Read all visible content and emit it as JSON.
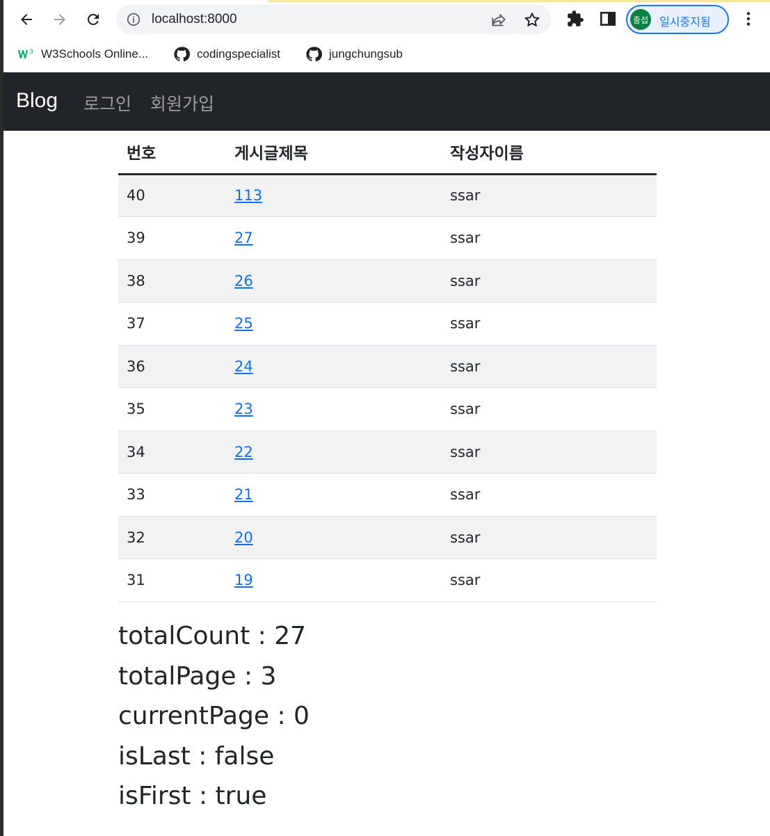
{
  "browser": {
    "url": "localhost:8000",
    "profile": {
      "avatar_text": "충섭",
      "label": "일시중지됨"
    },
    "bookmarks": [
      {
        "label": "W3Schools Online...",
        "icon": "w3schools-icon"
      },
      {
        "label": "codingspecialist",
        "icon": "github-icon"
      },
      {
        "label": "jungchungsub",
        "icon": "github-icon"
      }
    ]
  },
  "navbar": {
    "brand": "Blog",
    "links": [
      "로그인",
      "회원가입"
    ]
  },
  "table": {
    "headers": [
      "번호",
      "게시글제목",
      "작성자이름"
    ],
    "rows": [
      {
        "id": "40",
        "title": "113",
        "author": "ssar"
      },
      {
        "id": "39",
        "title": "27",
        "author": "ssar"
      },
      {
        "id": "38",
        "title": "26",
        "author": "ssar"
      },
      {
        "id": "37",
        "title": "25",
        "author": "ssar"
      },
      {
        "id": "36",
        "title": "24",
        "author": "ssar"
      },
      {
        "id": "35",
        "title": "23",
        "author": "ssar"
      },
      {
        "id": "34",
        "title": "22",
        "author": "ssar"
      },
      {
        "id": "33",
        "title": "21",
        "author": "ssar"
      },
      {
        "id": "32",
        "title": "20",
        "author": "ssar"
      },
      {
        "id": "31",
        "title": "19",
        "author": "ssar"
      }
    ]
  },
  "stats": [
    "totalCount : 27",
    "totalPage : 3",
    "currentPage : 0",
    "isLast : false",
    "isFirst : true"
  ],
  "colors": {
    "navbar_bg": "#212529",
    "link": "#0d6efd",
    "stripe": "#f2f2f2",
    "profile_accent": "#1a73e8"
  }
}
